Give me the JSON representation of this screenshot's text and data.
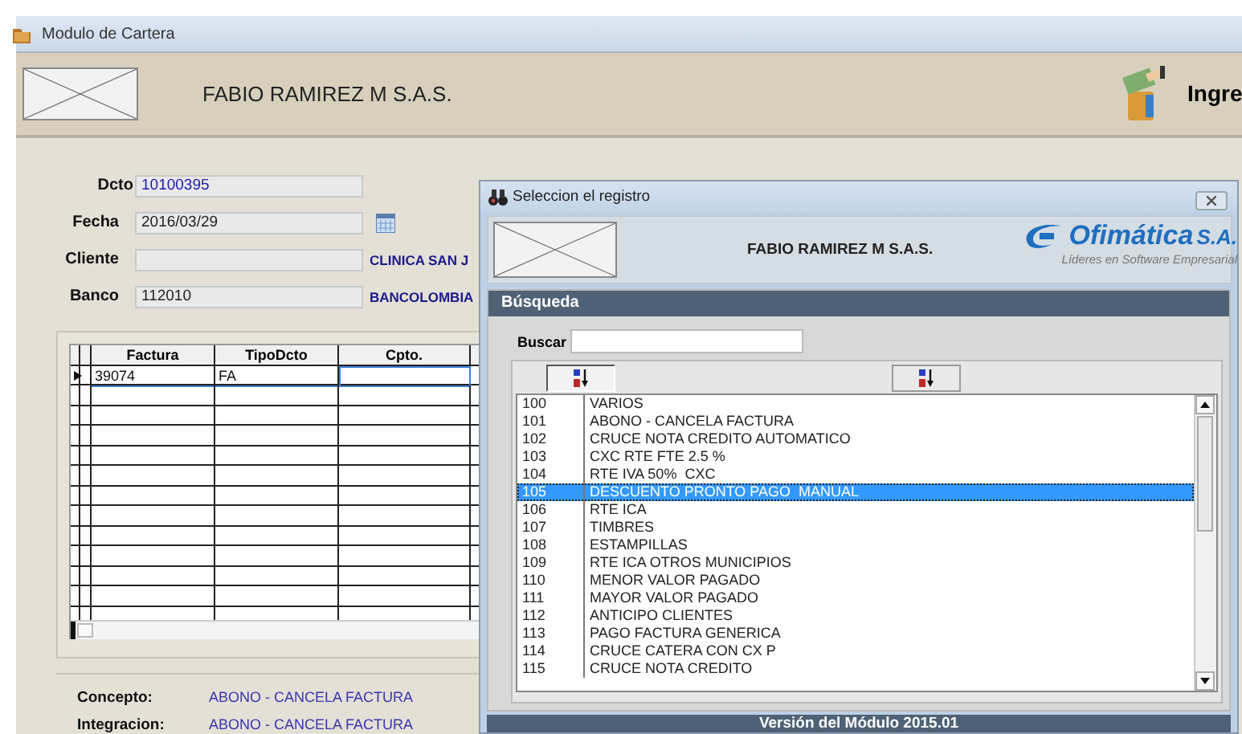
{
  "window": {
    "title": "Modulo de Cartera"
  },
  "header": {
    "company": "FABIO RAMIREZ M S.A.S.",
    "module": "Ingre"
  },
  "form": [
    {
      "label": "Dcto",
      "value": "10100395",
      "kind": "plain"
    },
    {
      "label": "Fecha",
      "value": "2016/03/29",
      "kind": "date"
    },
    {
      "label": "Cliente",
      "kind": "lookup",
      "description": "CLINICA SAN J"
    },
    {
      "label": "Banco",
      "value": "112010",
      "kind": "lookup",
      "description": "BANCOLOMBIA"
    }
  ],
  "grid": {
    "columns": [
      "Factura",
      "TipoDcto",
      "Cpto."
    ],
    "rows": [
      {
        "current": true,
        "cells": [
          "39074",
          "FA",
          ""
        ]
      }
    ]
  },
  "summary": [
    {
      "label": "Concepto:",
      "value": "ABONO - CANCELA FACTURA"
    },
    {
      "label": "Integracion:",
      "value": "ABONO - CANCELA FACTURA"
    }
  ],
  "dialog": {
    "title": "Seleccion el registro",
    "company": "FABIO RAMIREZ M S.A.S.",
    "logo": "Ofimática",
    "logo_suffix": "S.A.",
    "tagline": "Líderes en Software Empresarial",
    "section": "Búsqueda",
    "search_label": "Buscar",
    "sort_buttons": [
      {
        "pressed": true
      },
      {
        "pressed": false
      }
    ],
    "items": [
      {
        "code": "100",
        "name": "VARIOS",
        "selected": false
      },
      {
        "code": "101",
        "name": "ABONO - CANCELA FACTURA",
        "selected": false
      },
      {
        "code": "102",
        "name": "CRUCE NOTA CREDITO AUTOMATICO",
        "selected": false
      },
      {
        "code": "103",
        "name": "CXC RTE FTE 2.5 %",
        "selected": false
      },
      {
        "code": "104",
        "name": "RTE IVA 50%  CXC",
        "selected": false
      },
      {
        "code": "105",
        "name": "DESCUENTO PRONTO PAGO  MANUAL",
        "selected": true
      },
      {
        "code": "106",
        "name": "RTE ICA",
        "selected": false
      },
      {
        "code": "107",
        "name": "TIMBRES",
        "selected": false
      },
      {
        "code": "108",
        "name": "ESTAMPILLAS",
        "selected": false
      },
      {
        "code": "109",
        "name": "RTE ICA OTROS MUNICIPIOS",
        "selected": false
      },
      {
        "code": "110",
        "name": "MENOR VALOR PAGADO",
        "selected": false
      },
      {
        "code": "111",
        "name": "MAYOR VALOR PAGADO",
        "selected": false
      },
      {
        "code": "112",
        "name": "ANTICIPO CLIENTES",
        "selected": false
      },
      {
        "code": "113",
        "name": "PAGO FACTURA GENERICA",
        "selected": false
      },
      {
        "code": "114",
        "name": "CRUCE CATERA CON CX P",
        "selected": false
      },
      {
        "code": "115",
        "name": "CRUCE NOTA CREDITO",
        "selected": false
      }
    ],
    "footer": "Versión del Módulo 2015.01"
  }
}
